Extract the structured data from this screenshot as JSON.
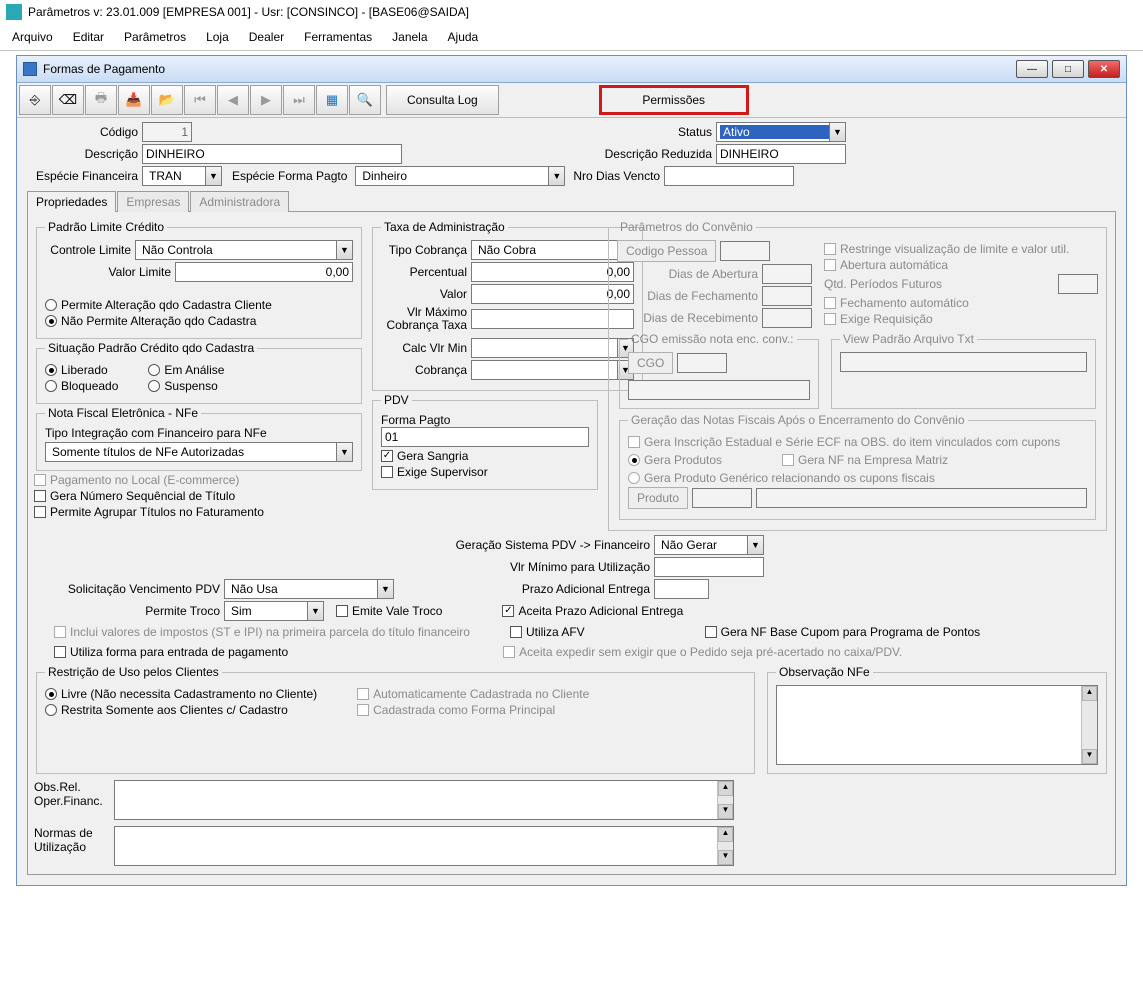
{
  "app": {
    "title": "Parâmetros  v: 23.01.009   [EMPRESA 001] - Usr: [CONSINCO] - [BASE06@SAIDA]"
  },
  "menu": [
    "Arquivo",
    "Editar",
    "Parâmetros",
    "Loja",
    "Dealer",
    "Ferramentas",
    "Janela",
    "Ajuda"
  ],
  "window": {
    "title": "Formas de Pagamento"
  },
  "toolbar": {
    "consultaLog": "Consulta Log",
    "permissoes": "Permissões"
  },
  "header": {
    "codigo_lbl": "Código",
    "codigo": "1",
    "status_lbl": "Status",
    "status": "Ativo",
    "descricao_lbl": "Descrição",
    "descricao": "DINHEIRO",
    "descricaoRed_lbl": "Descrição Reduzida",
    "descricaoRed": "DINHEIRO",
    "especieFin_lbl": "Espécie Financeira",
    "especieFin": "TRAN",
    "especiePagto_lbl": "Espécie Forma Pagto",
    "especiePagto": "Dinheiro",
    "nroDias_lbl": "Nro Dias Vencto",
    "nroDias": ""
  },
  "tabs": [
    "Propriedades",
    "Empresas",
    "Administradora"
  ],
  "grp": {
    "padraoLimite": {
      "title": "Padrão Limite Crédito",
      "controleLimite_lbl": "Controle Limite",
      "controleLimite": "Não Controla",
      "valorLimite_lbl": "Valor Limite",
      "valorLimite": "0,00",
      "r1": "Permite Alteração qdo Cadastra Cliente",
      "r2": "Não Permite Alteração qdo Cadastra"
    },
    "sitPadrao": {
      "title": "Situação Padrão Crédito qdo Cadastra",
      "r1": "Liberado",
      "r2": "Bloqueado",
      "r3": "Em Análise",
      "r4": "Suspenso"
    },
    "nfe": {
      "title": "Nota Fiscal Eletrônica - NFe",
      "lbl": "Tipo Integração com Financeiro para NFe",
      "val": "Somente títulos de NFe Autorizadas"
    },
    "chk": {
      "pagLocal": "Pagamento no Local (E-commerce)",
      "geraNum": "Gera Número Sequêncial de Título",
      "permAgr": "Permite Agrupar Títulos no Faturamento"
    },
    "taxa": {
      "title": "Taxa de Administração",
      "tipoCob_lbl": "Tipo Cobrança",
      "tipoCob": "Não Cobra",
      "perc_lbl": "Percentual",
      "perc": "0,00",
      "valor_lbl": "Valor",
      "valor": "0,00",
      "vlrMax_lbl": "Vlr Máximo Cobrança Taxa",
      "vlrMax": "",
      "calcMin_lbl": "Calc Vlr Min",
      "calcMin": "",
      "cobranca_lbl": "Cobrança",
      "cobranca": ""
    },
    "pdv": {
      "title": "PDV",
      "formaPagto_lbl": "Forma Pagto",
      "formaPagto": "01",
      "geraSangria": "Gera Sangria",
      "exigeSup": "Exige Supervisor"
    },
    "convenio": {
      "title": "Parâmetros do Convênio",
      "codPessoa": "Codigo Pessoa",
      "diasAbert": "Dias de Abertura",
      "diasFech": "Dias de Fechamento",
      "diasReceb": "Dias de Recebimento",
      "restringe": "Restringe visualização de limite e valor util.",
      "abertura": "Abertura automática",
      "qtdPer_lbl": "Qtd. Períodos Futuros",
      "fechAuto": "Fechamento automático",
      "exigeReq": "Exige Requisição"
    },
    "cgo": {
      "title": "CGO emissão nota enc. conv.:",
      "btn": "CGO"
    },
    "viewPadrao": {
      "title": "View Padrão Arquivo Txt"
    },
    "gerNotas": {
      "title": "Geração das Notas Fiscais Após o Encerramento do Convênio",
      "c1": "Gera Inscrição Estadual e Série ECF na OBS. do item vinculados com cupons",
      "r1": "Gera Produtos",
      "c2": "Gera NF na Empresa Matriz",
      "r2": "Gera Produto Genérico relacionando os cupons fiscais",
      "btn": "Produto"
    }
  },
  "mid": {
    "gerPDV_lbl": "Geração Sistema PDV -> Financeiro",
    "gerPDV": "Não Gerar",
    "vlrMin_lbl": "Vlr Mínimo para Utilização",
    "vlrMin": "",
    "prazoAd_lbl": "Prazo Adicional Entrega",
    "prazoAd": "",
    "solVenc_lbl": "Solicitação Vencimento PDV",
    "solVenc": "Não Usa",
    "permTroco_lbl": "Permite Troco",
    "permTroco": "Sim",
    "emiteVale": "Emite Vale Troco",
    "aceitaPrazo": "Aceita Prazo Adicional Entrega",
    "incluiImp": "Inclui valores de impostos (ST e IPI) na primeira parcela do título financeiro",
    "utilizaAFV": "Utiliza AFV",
    "geraNFBase": "Gera NF Base Cupom para Programa de Pontos",
    "utilizaForma": "Utiliza forma para entrada de pagamento",
    "aceitaExp": "Aceita expedir sem exigir que o Pedido seja pré-acertado no caixa/PDV."
  },
  "restr": {
    "title": "Restrição de Uso pelos Clientes",
    "r1": "Livre (Não necessita Cadastramento no Cliente)",
    "r2": "Restrita Somente aos Clientes c/ Cadastro",
    "r3": "Automaticamente Cadastrada no Cliente",
    "r4": "Cadastrada como Forma Principal"
  },
  "obsNfe": {
    "title": "Observação NFe"
  },
  "bottom": {
    "obsRel": "Obs.Rel. Oper.Financ.",
    "normas": "Normas de Utilização"
  }
}
